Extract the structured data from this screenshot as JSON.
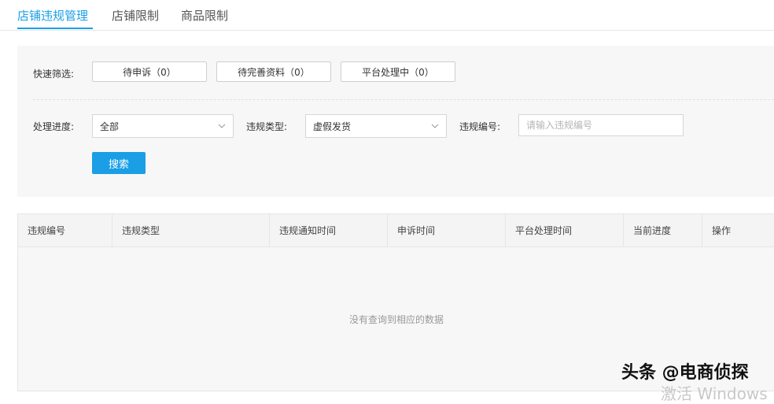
{
  "tabs": [
    {
      "label": "店铺违规管理",
      "active": true
    },
    {
      "label": "店铺限制",
      "active": false
    },
    {
      "label": "商品限制",
      "active": false
    }
  ],
  "filters": {
    "quick_label": "快速筛选:",
    "quick_buttons": [
      "待申诉（0）",
      "待完善资料（0）",
      "平台处理中（0）"
    ],
    "progress_label": "处理进度:",
    "progress_value": "全部",
    "type_label": "违规类型:",
    "type_value": "虚假发货",
    "id_label": "违规编号:",
    "id_placeholder": "请输入违规编号",
    "search_label": "搜索"
  },
  "table": {
    "columns": [
      "违规编号",
      "违规类型",
      "违规通知时间",
      "申诉时间",
      "平台处理时间",
      "当前进度",
      "操作"
    ],
    "empty_text": "没有查询到相应的数据"
  },
  "watermark": {
    "text": "头条 @电商侦探",
    "activate_text": "激活 Windows"
  },
  "colors": {
    "accent": "#1a9fe6"
  }
}
